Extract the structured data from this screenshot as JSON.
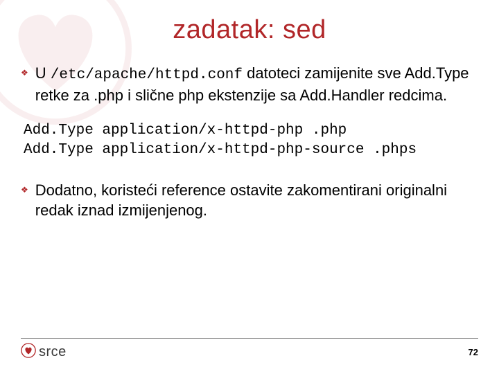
{
  "title": "zadatak: sed",
  "bullets": [
    {
      "segments": [
        {
          "t": "U ",
          "mono": false
        },
        {
          "t": "/etc/apache/httpd.conf",
          "mono": true
        },
        {
          "t": " datoteci zamijenite sve Add.Type retke za .php i slične php ekstenzije sa Add.Handler redcima.",
          "mono": false
        }
      ]
    },
    {
      "segments": [
        {
          "t": "Dodatno, koristeći reference ostavite zakomentirani originalni redak iznad izmijenjenog.",
          "mono": false
        }
      ]
    }
  ],
  "code": "Add.Type application/x-httpd-php .php\nAdd.Type application/x-httpd-php-source .phps",
  "footer": {
    "brand": "srce",
    "page": "72"
  }
}
